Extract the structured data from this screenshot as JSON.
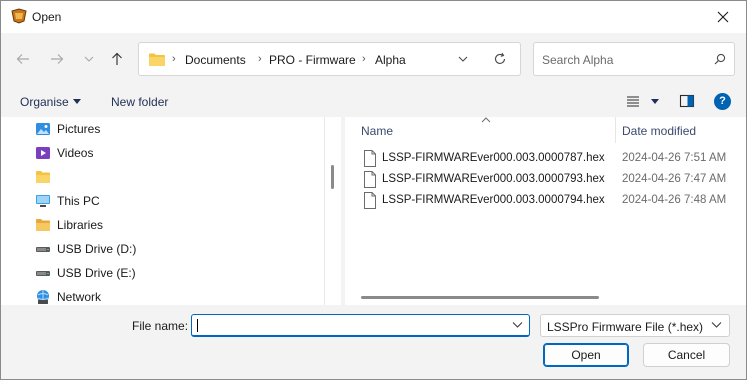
{
  "window": {
    "title": "Open"
  },
  "address": {
    "crumbs": [
      "Documents",
      "PRO - Firmware",
      "Alpha"
    ]
  },
  "search": {
    "placeholder": "Search Alpha"
  },
  "toolbar": {
    "organise_label": "Organise",
    "new_folder_label": "New folder",
    "help_label": "?"
  },
  "nav_items": [
    {
      "label": "Pictures",
      "icon": "pictures-icon"
    },
    {
      "label": "Videos",
      "icon": "videos-icon"
    },
    {
      "label": "",
      "icon": "folder-icon"
    },
    {
      "label": "This PC",
      "icon": "this-pc-icon"
    },
    {
      "label": "Libraries",
      "icon": "libraries-icon"
    },
    {
      "label": "USB Drive (D:)",
      "icon": "usb-drive-icon"
    },
    {
      "label": "USB Drive (E:)",
      "icon": "usb-drive-icon"
    },
    {
      "label": "Network",
      "icon": "network-icon"
    }
  ],
  "columns": {
    "name": "Name",
    "date_modified": "Date modified"
  },
  "files": [
    {
      "name": "LSSP-FIRMWAREver000.003.0000787.hex",
      "date": "2024-04-26 7:51 AM"
    },
    {
      "name": "LSSP-FIRMWAREver000.003.0000793.hex",
      "date": "2024-04-26 7:47 AM"
    },
    {
      "name": "LSSP-FIRMWAREver000.003.0000794.hex",
      "date": "2024-04-26 7:48 AM"
    }
  ],
  "bottom": {
    "file_name_label": "File name:",
    "file_name_value": "",
    "file_type": "LSSPro Firmware File (*.hex)",
    "open_label": "Open",
    "cancel_label": "Cancel"
  },
  "colors": {
    "accent": "#0067c0",
    "folder": "#f5c242"
  }
}
